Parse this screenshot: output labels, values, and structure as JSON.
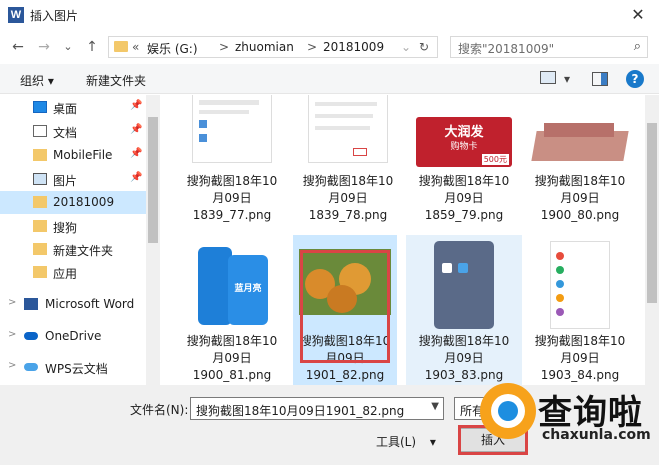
{
  "window": {
    "title": "插入图片",
    "app_icon": "W",
    "close": "✕"
  },
  "nav": {
    "back": "←",
    "forward": "→",
    "dropdown": "⌄",
    "up": "↑",
    "path_prefix": "«",
    "crumbs": [
      "娱乐 (G:)",
      "zhuomian",
      "20181009"
    ],
    "separator": ">",
    "refresh": "↻",
    "search_placeholder": "搜索\"20181009\""
  },
  "toolbar": {
    "organize": "组织 ▾",
    "new_folder": "新建文件夹",
    "view_arrow": "▾",
    "help": "?"
  },
  "sidebar": {
    "items": [
      {
        "label": "桌面",
        "pinned": true,
        "icon": "desktop-icon"
      },
      {
        "label": "文档",
        "pinned": true,
        "icon": "document-icon"
      },
      {
        "label": "MobileFile",
        "pinned": true,
        "icon": "folder-icon"
      },
      {
        "label": "图片",
        "pinned": true,
        "icon": "picture-icon"
      },
      {
        "label": "20181009",
        "pinned": false,
        "icon": "folder-icon",
        "selected": true
      },
      {
        "label": "搜狗",
        "pinned": false,
        "icon": "folder-icon"
      },
      {
        "label": "新建文件夹",
        "pinned": false,
        "icon": "folder-icon"
      },
      {
        "label": "应用",
        "pinned": false,
        "icon": "folder-icon"
      }
    ],
    "roots": [
      {
        "label": "Microsoft Word",
        "icon": "word-icon"
      },
      {
        "label": "OneDrive",
        "icon": "cloud-icon"
      },
      {
        "label": "WPS云文档",
        "icon": "wps-cloud-icon"
      }
    ],
    "pin_glyph": "📌",
    "expand_glyph": ">"
  },
  "files": [
    {
      "name": [
        "搜狗截图18年10",
        "月09日",
        "1839_77.png"
      ],
      "thumb": "screenshot"
    },
    {
      "name": [
        "搜狗截图18年10",
        "月09日",
        "1839_78.png"
      ],
      "thumb": "screenshot"
    },
    {
      "name": [
        "搜狗截图18年10",
        "月09日",
        "1859_79.png"
      ],
      "thumb": "card",
      "card_text": "大润发",
      "card_sub": "购物卡",
      "card_value": "500元"
    },
    {
      "name": [
        "搜狗截图18年10",
        "月09日",
        "1900_80.png"
      ],
      "thumb": "money"
    },
    {
      "name": [
        "搜狗截图18年10",
        "月09日",
        "1900_81.png"
      ],
      "thumb": "detergent",
      "brand": "蓝月亮"
    },
    {
      "name": [
        "搜狗截图18年10",
        "月09日",
        "1901_82.png"
      ],
      "thumb": "mooncake",
      "selected": true
    },
    {
      "name": [
        "搜狗截图18年10",
        "月09日",
        "1903_83.png"
      ],
      "thumb": "phone"
    },
    {
      "name": [
        "搜狗截图18年10",
        "月09日",
        "1903_84.png"
      ],
      "thumb": "phone-list"
    }
  ],
  "bottom": {
    "filename_label": "文件名(N):",
    "filename_value": "搜狗截图18年10月09日1901_82.png",
    "filter_label": "所有",
    "tools_label": "工具(L)",
    "tools_arrow": "▾",
    "insert_label": "插入"
  },
  "watermark": {
    "brand": "查询啦",
    "url": "chaxunla.com"
  },
  "colors": {
    "selection": "#cce8ff",
    "highlight_red": "#d94545",
    "folder": "#f3c86a",
    "help_blue": "#1979ca",
    "watermark_orange": "#f7a21b",
    "watermark_blue": "#1d8ee0"
  }
}
